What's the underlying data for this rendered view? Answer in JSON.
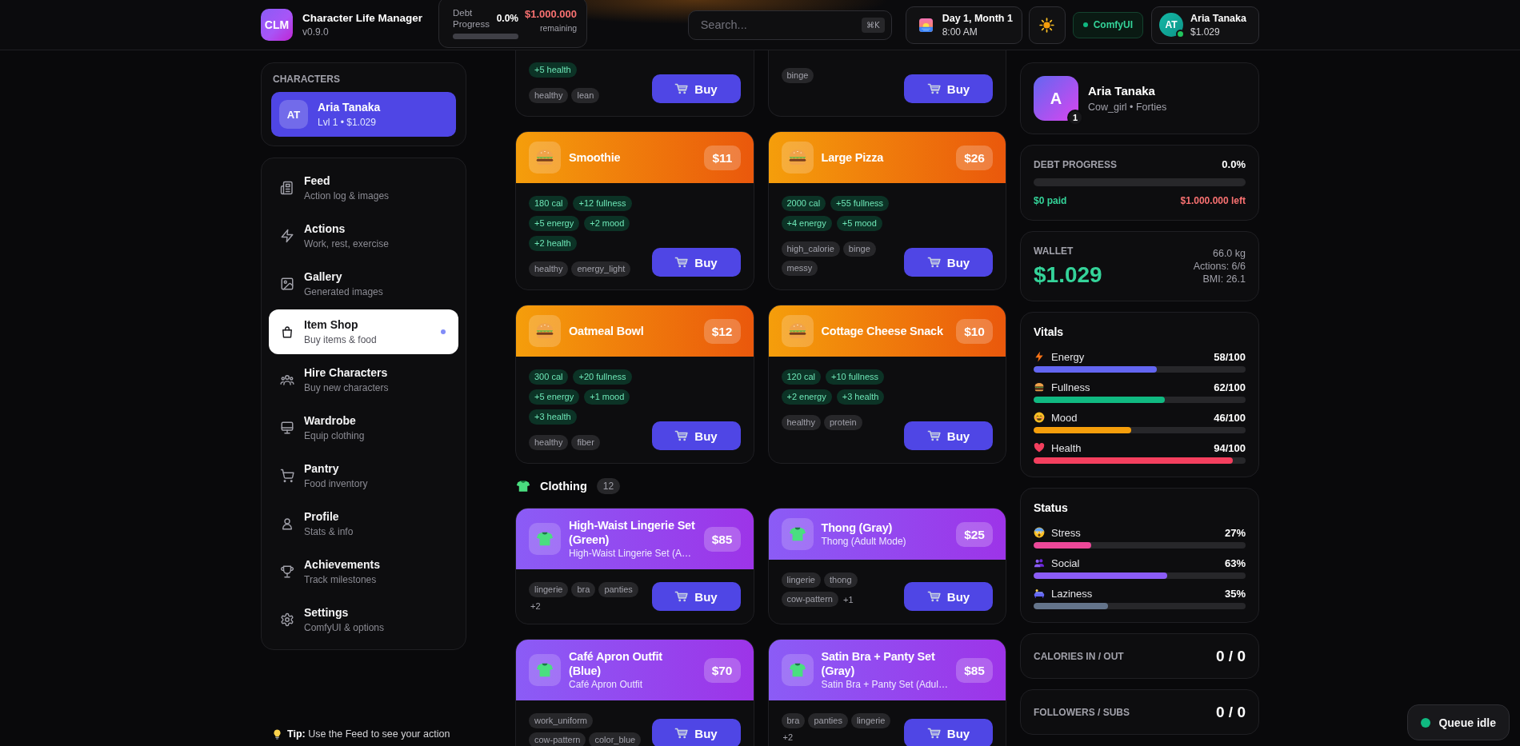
{
  "header": {
    "logo": "CLM",
    "title": "Character Life Manager",
    "version": "v0.9.0",
    "debt": {
      "label": "Debt Progress",
      "percent": "0.0%",
      "amount": "$1.000.000",
      "note": "remaining"
    },
    "search": {
      "placeholder": "Search...",
      "shortcut": "⌘K"
    },
    "clock": {
      "date": "Day 1, Month 1",
      "time": "8:00 AM"
    },
    "comfyui": {
      "label": "ComfyUI",
      "online": true
    },
    "user": {
      "initials": "AT",
      "name": "Aria Tanaka",
      "balance": "$1.029",
      "online": true
    }
  },
  "sidebar": {
    "characters": {
      "title": "CHARACTERS",
      "items": [
        {
          "initials": "AT",
          "name": "Aria Tanaka",
          "detail": "Lvl 1 • $1.029",
          "selected": true
        }
      ]
    },
    "nav": [
      {
        "label": "Feed",
        "sub": "Action log & images",
        "selected": false
      },
      {
        "label": "Actions",
        "sub": "Work, rest, exercise",
        "selected": false
      },
      {
        "label": "Gallery",
        "sub": "Generated images",
        "selected": false
      },
      {
        "label": "Item Shop",
        "sub": "Buy items & food",
        "selected": true
      },
      {
        "label": "Hire Characters",
        "sub": "Buy new characters",
        "selected": false
      },
      {
        "label": "Wardrobe",
        "sub": "Equip clothing",
        "selected": false
      },
      {
        "label": "Pantry",
        "sub": "Food inventory",
        "selected": false
      },
      {
        "label": "Profile",
        "sub": "Stats & info",
        "selected": false
      },
      {
        "label": "Achievements",
        "sub": "Track milestones",
        "selected": false
      },
      {
        "label": "Settings",
        "sub": "ComfyUI & options",
        "selected": false
      }
    ],
    "tip": "**Tip:** Use the Feed to see your action"
  },
  "shop": {
    "partial_items": [
      {
        "effects": [
          "+5 health"
        ],
        "tags": [
          "healthy",
          "lean"
        ],
        "buy": "Buy"
      },
      {
        "tags": [
          "binge"
        ],
        "buy": "Buy"
      }
    ],
    "food": [
      {
        "name": "Smoothie",
        "price": "$11",
        "effects": [
          "180 cal",
          "+12 fullness",
          "+5 energy",
          "+2 mood",
          "+2 health"
        ],
        "tags": [
          "healthy",
          "energy_light"
        ],
        "buy": "Buy"
      },
      {
        "name": "Large Pizza",
        "price": "$26",
        "effects": [
          "2000 cal",
          "+55 fullness",
          "+4 energy",
          "+5 mood"
        ],
        "tags": [
          "high_calorie",
          "binge",
          "messy"
        ],
        "buy": "Buy"
      },
      {
        "name": "Oatmeal Bowl",
        "price": "$12",
        "effects": [
          "300 cal",
          "+20 fullness",
          "+5 energy",
          "+1 mood",
          "+3 health"
        ],
        "tags": [
          "healthy",
          "fiber"
        ],
        "buy": "Buy"
      },
      {
        "name": "Cottage Cheese Snack",
        "price": "$10",
        "effects": [
          "120 cal",
          "+10 fullness",
          "+2 energy",
          "+3 health"
        ],
        "tags": [
          "healthy",
          "protein"
        ],
        "buy": "Buy"
      }
    ],
    "clothing": {
      "title": "Clothing",
      "count": "12",
      "items": [
        {
          "name": "High-Waist Lingerie Set (Green)",
          "description": "High-Waist Lingerie Set (A…",
          "price": "$85",
          "tags": [
            "lingerie",
            "bra",
            "panties"
          ],
          "more": "+2",
          "buy": "Buy"
        },
        {
          "name": "Thong (Gray)",
          "description": "Thong (Adult Mode)",
          "price": "$25",
          "tags": [
            "lingerie",
            "thong",
            "cow-pattern"
          ],
          "more": "+1",
          "buy": "Buy"
        },
        {
          "name": "Café Apron Outfit (Blue)",
          "description": "Café Apron Outfit",
          "price": "$70",
          "tags": [
            "work_uniform",
            "cow-pattern",
            "color_blue"
          ],
          "buy": "Buy"
        },
        {
          "name": "Satin Bra + Panty Set (Gray)",
          "description": "Satin Bra + Panty Set (Adul…",
          "price": "$85",
          "tags": [
            "bra",
            "panties",
            "lingerie"
          ],
          "more": "+2",
          "buy": "Buy"
        }
      ]
    }
  },
  "summary": {
    "profile": {
      "initial": "A",
      "level": "1",
      "name": "Aria Tanaka",
      "sub": "Cow_girl • Forties"
    },
    "debt": {
      "label": "DEBT PROGRESS",
      "percent": "0.0%",
      "paid": "$0 paid",
      "left": "$1.000.000 left"
    },
    "wallet": {
      "label": "WALLET",
      "amount": "$1.029",
      "stats": [
        "66.0 kg",
        "Actions: 6/6",
        "BMI: 26.1"
      ]
    },
    "vitals": {
      "title": "Vitals",
      "items": [
        {
          "label": "Energy",
          "value": "58/100",
          "level": 0.58,
          "color": "#6366f1"
        },
        {
          "label": "Fullness",
          "value": "62/100",
          "level": 0.62,
          "color": "#10b981"
        },
        {
          "label": "Mood",
          "value": "46/100",
          "level": 0.46,
          "color": "#f59e0b"
        },
        {
          "label": "Health",
          "value": "94/100",
          "level": 0.94,
          "color": "#f43f5e"
        }
      ]
    },
    "status": {
      "title": "Status",
      "items": [
        {
          "label": "Stress",
          "value": "27%",
          "level": 0.27,
          "color": "#ec4899"
        },
        {
          "label": "Social",
          "value": "63%",
          "level": 0.63,
          "color": "#8b5cf6"
        },
        {
          "label": "Laziness",
          "value": "35%",
          "level": 0.35,
          "color": "#64748b"
        }
      ]
    },
    "counters": [
      {
        "label": "CALORIES IN / OUT",
        "value": "0 / 0"
      },
      {
        "label": "FOLLOWERS / SUBS",
        "value": "0 / 0"
      }
    ]
  },
  "queue": {
    "label": "Queue idle"
  }
}
